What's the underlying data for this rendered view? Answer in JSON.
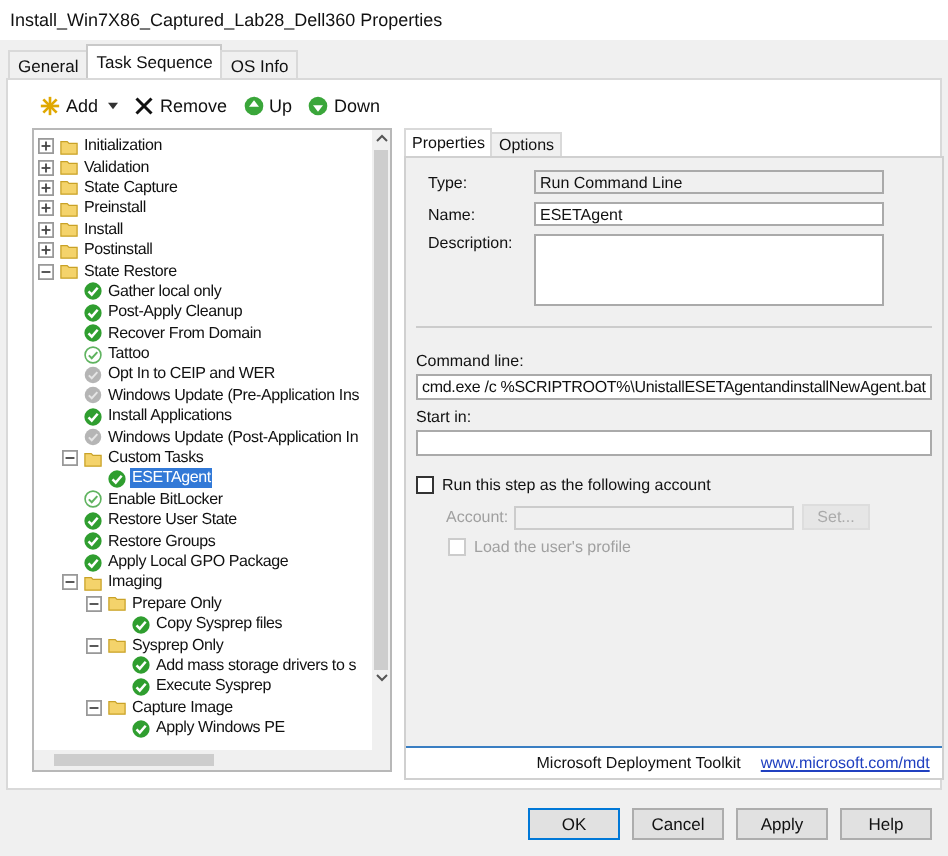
{
  "window": {
    "title": "Install_Win7X86_Captured_Lab28_Dell360 Properties"
  },
  "tabs": [
    {
      "label": "General",
      "selected": false
    },
    {
      "label": "Task Sequence",
      "selected": true
    },
    {
      "label": "OS Info",
      "selected": false
    }
  ],
  "toolbar": [
    {
      "label": "Add",
      "kind": "add"
    },
    {
      "label": "Remove",
      "kind": "remove"
    },
    {
      "label": "Up",
      "kind": "up"
    },
    {
      "label": "Down",
      "kind": "down"
    }
  ],
  "tree": [
    {
      "label": "Initialization",
      "kind": "folder",
      "expanded": false,
      "selected": false
    },
    {
      "label": "Validation",
      "kind": "folder",
      "expanded": false,
      "selected": false
    },
    {
      "label": "State Capture",
      "kind": "folder",
      "expanded": false,
      "selected": false
    },
    {
      "label": "Preinstall",
      "kind": "folder",
      "expanded": false,
      "selected": false
    },
    {
      "label": "Install",
      "kind": "folder",
      "expanded": false,
      "selected": false
    },
    {
      "label": "Postinstall",
      "kind": "folder",
      "expanded": false,
      "selected": false
    },
    {
      "label": "State Restore",
      "kind": "folder",
      "expanded": true,
      "selected": false,
      "children": [
        {
          "label": "Gather local only",
          "kind": "ok",
          "selected": false
        },
        {
          "label": "Post-Apply Cleanup",
          "kind": "ok",
          "selected": false
        },
        {
          "label": "Recover From Domain",
          "kind": "ok",
          "selected": false
        },
        {
          "label": "Tattoo",
          "kind": "light",
          "selected": false
        },
        {
          "label": "Opt In to CEIP and WER",
          "kind": "off",
          "selected": false
        },
        {
          "label": "Windows Update (Pre-Application Ins",
          "kind": "off",
          "selected": false
        },
        {
          "label": "Install Applications",
          "kind": "ok",
          "selected": false
        },
        {
          "label": "Windows Update (Post-Application In",
          "kind": "off",
          "selected": false
        },
        {
          "label": "Custom Tasks",
          "kind": "folder",
          "expanded": true,
          "selected": false,
          "children": [
            {
              "label": "ESETAgent",
              "kind": "ok",
              "selected": true
            }
          ]
        },
        {
          "label": "Enable BitLocker",
          "kind": "light",
          "selected": false
        },
        {
          "label": "Restore User State",
          "kind": "ok",
          "selected": false
        },
        {
          "label": "Restore Groups",
          "kind": "ok",
          "selected": false
        },
        {
          "label": "Apply Local GPO Package",
          "kind": "ok",
          "selected": false
        },
        {
          "label": "Imaging",
          "kind": "folder",
          "expanded": true,
          "selected": false,
          "children": [
            {
              "label": "Prepare Only",
              "kind": "folder",
              "expanded": true,
              "selected": false,
              "children": [
                {
                  "label": "Copy Sysprep files",
                  "kind": "ok",
                  "selected": false
                }
              ]
            },
            {
              "label": "Sysprep Only",
              "kind": "folder",
              "expanded": true,
              "selected": false,
              "children": [
                {
                  "label": "Add mass storage drivers to s",
                  "kind": "ok",
                  "selected": false
                },
                {
                  "label": "Execute Sysprep",
                  "kind": "ok",
                  "selected": false
                }
              ]
            },
            {
              "label": "Capture Image",
              "kind": "folder",
              "expanded": true,
              "selected": false,
              "children": [
                {
                  "label": "Apply Windows PE",
                  "kind": "ok",
                  "selected": false
                }
              ]
            }
          ]
        }
      ]
    }
  ],
  "detail_tabs": [
    {
      "label": "Properties",
      "selected": true
    },
    {
      "label": "Options",
      "selected": false
    }
  ],
  "properties": {
    "type_label": "Type:",
    "type_value": "Run Command Line",
    "name_label": "Name:",
    "name_value": "ESETAgent",
    "description_label": "Description:",
    "command_label": "Command line:",
    "command_value": "cmd.exe /c %SCRIPTROOT%\\UnistallESETAgentandinstallNewAgent.bat",
    "start_label": "Start in:",
    "run_as": {
      "label": "Run this step as the following account",
      "checked": false
    },
    "account_label": "Account:",
    "set_button": "Set...",
    "load_profile": {
      "label": "Load the user's profile",
      "checked": false
    }
  },
  "footer": {
    "text": "Microsoft Deployment Toolkit",
    "link": "www.microsoft.com/mdt"
  },
  "buttons": [
    {
      "label": "OK",
      "default": true
    },
    {
      "label": "Cancel",
      "default": false
    },
    {
      "label": "Apply",
      "default": false
    },
    {
      "label": "Help",
      "default": false
    }
  ]
}
